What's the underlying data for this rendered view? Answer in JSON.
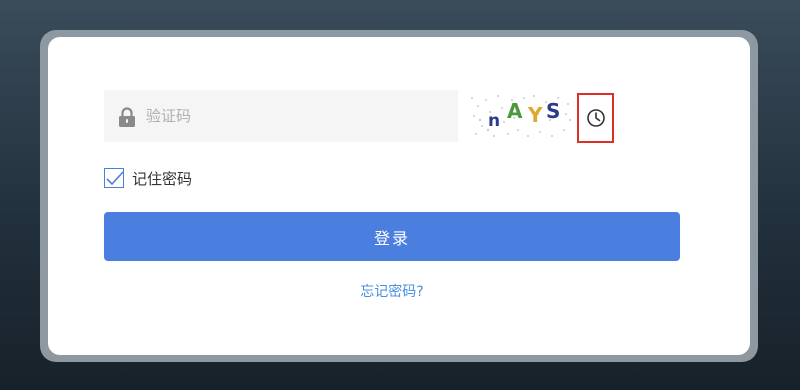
{
  "form": {
    "captcha_placeholder": "验证码",
    "captcha_code": "nAYS",
    "remember_label": "记住密码",
    "remember_checked": true,
    "login_label": "登录",
    "forgot_label": "忘记密码?"
  },
  "icons": {
    "field_icon": "lock-icon",
    "refresh_icon": "clock-icon"
  },
  "colors": {
    "primary": "#4a7fe0",
    "link": "#4a8ee0",
    "highlight_border": "#d9312a",
    "captcha_letters": [
      "#2a3c8c",
      "#4a9a3a",
      "#e0a82a",
      "#2a3c8c"
    ]
  }
}
